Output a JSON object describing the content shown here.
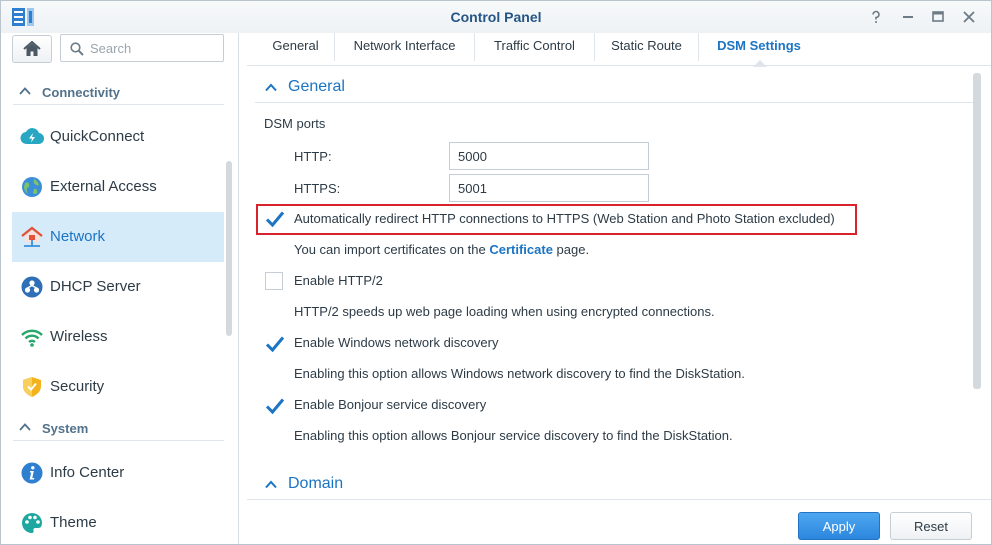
{
  "window": {
    "title": "Control Panel"
  },
  "search": {
    "placeholder": "Search"
  },
  "sidebar": {
    "sections": [
      {
        "label": "Connectivity"
      },
      {
        "label": "System"
      }
    ],
    "items": [
      {
        "label": "QuickConnect",
        "icon": "quickconnect-icon"
      },
      {
        "label": "External Access",
        "icon": "globe-icon"
      },
      {
        "label": "Network",
        "icon": "house-network-icon",
        "active": true
      },
      {
        "label": "DHCP Server",
        "icon": "dhcp-icon"
      },
      {
        "label": "Wireless",
        "icon": "wifi-icon"
      },
      {
        "label": "Security",
        "icon": "shield-icon"
      },
      {
        "label": "Info Center",
        "icon": "info-icon"
      },
      {
        "label": "Theme",
        "icon": "palette-icon"
      }
    ]
  },
  "tabs": [
    {
      "label": "General"
    },
    {
      "label": "Network Interface"
    },
    {
      "label": "Traffic Control"
    },
    {
      "label": "Static Route"
    },
    {
      "label": "DSM Settings",
      "active": true
    }
  ],
  "main": {
    "general_header": "General",
    "dsm_ports_label": "DSM ports",
    "http_label": "HTTP:",
    "http_value": "5000",
    "https_label": "HTTPS:",
    "https_value": "5001",
    "redirect": {
      "label": "Automatically redirect HTTP connections to HTTPS (Web Station and Photo Station excluded)",
      "checked": true
    },
    "cert_note_prefix": "You can import certificates on the ",
    "cert_link": "Certificate",
    "cert_note_suffix": " page.",
    "http2": {
      "label": "Enable HTTP/2",
      "checked": false,
      "desc": "HTTP/2 speeds up web page loading when using encrypted connections."
    },
    "windows_discovery": {
      "label": "Enable Windows network discovery",
      "checked": true,
      "desc": "Enabling this option allows Windows network discovery to find the DiskStation."
    },
    "bonjour": {
      "label": "Enable Bonjour service discovery",
      "checked": true,
      "desc": "Enabling this option allows Bonjour service discovery to find the DiskStation."
    },
    "domain_header": "Domain"
  },
  "footer": {
    "apply_label": "Apply",
    "reset_label": "Reset"
  },
  "colors": {
    "accent": "#1b74c4",
    "highlight_border": "#d9232c",
    "active_bg": "#d5ebfa"
  }
}
